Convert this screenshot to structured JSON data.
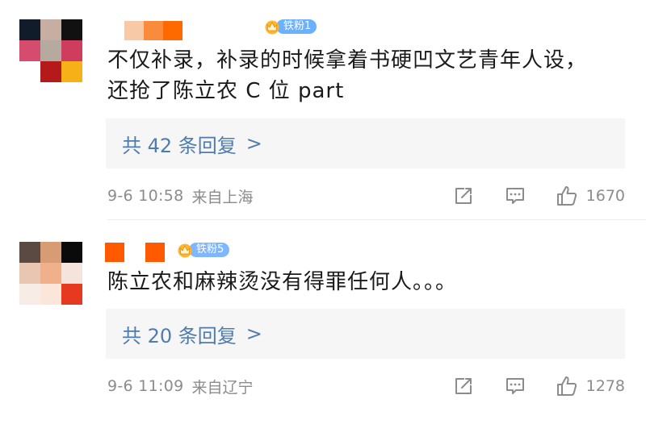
{
  "comments": [
    {
      "avatar_colors": [
        "#111c2b",
        "#c7aea3",
        "#111111",
        "#d54c6e",
        "#b6a9a0",
        "#cf3d5e",
        "#ffffff",
        "#b41a1a",
        "#f7b018"
      ],
      "username_colors": [
        "#ffffff",
        "#f8c9a6",
        "#f98b3c",
        "#ff6a00"
      ],
      "fan_badge": {
        "label": "铁粉1",
        "color": "#6cb1ff"
      },
      "text_lines": [
        "不仅补录，补录的时候拿着书硬凹文艺青年人设，",
        "还抢了陈立农 C 位 part"
      ],
      "replies_label": "共 42 条回复",
      "replies_chevron": ">",
      "time": "9-6 10:58",
      "location": "来自上海",
      "likes": "1670"
    },
    {
      "avatar_colors": [
        "#5a4a42",
        "#d89c74",
        "#0a0a0a",
        "#e8c6b2",
        "#f0b08c",
        "#f4e4dc",
        "#f7ede6",
        "#fce6da",
        "#e63a20"
      ],
      "username_colors": [
        "#ff5a00",
        "#ffffff",
        "#ff5a00"
      ],
      "fan_badge": {
        "label": "铁粉5",
        "color": "#7fb7ff"
      },
      "text_lines": [
        "陈立农和麻辣烫没有得罪任何人。。。"
      ],
      "replies_label": "共 20 条回复",
      "replies_chevron": ">",
      "time": "9-6 11:09",
      "location": "来自辽宁",
      "likes": "1278"
    }
  ],
  "icons": {
    "share": "share-icon",
    "comment": "comment-icon",
    "like": "thumbs-up-icon",
    "crown": "crown-icon"
  },
  "colors": {
    "link_blue": "#4f7cae",
    "meta_gray": "#8c8c8c",
    "reply_bg": "#f6f6f6"
  }
}
